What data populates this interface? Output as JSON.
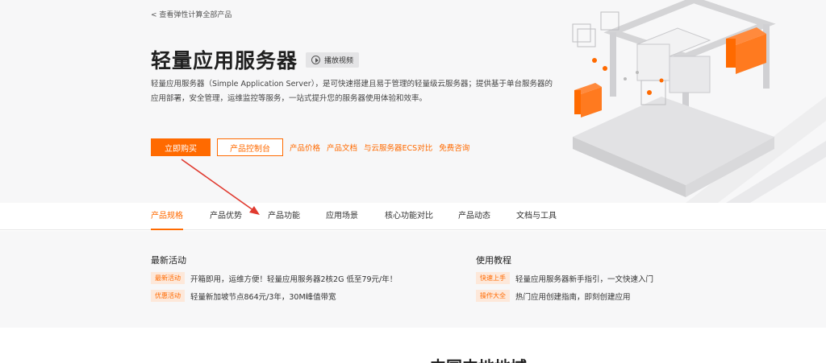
{
  "hero": {
    "back_link": "< 查看弹性计算全部产品",
    "title": "轻量应用服务器",
    "video_label": "播放视频",
    "description": "轻量应用服务器（Simple Application Server），是可快速搭建且易于管理的轻量级云服务器；提供基于单台服务器的应用部署，安全管理，运维监控等服务，一站式提升您的服务器使用体验和效率。",
    "buy_label": "立即购买",
    "console_label": "产品控制台",
    "links": [
      "产品价格",
      "产品文档",
      "与云服务器ECS对比",
      "免费咨询"
    ]
  },
  "tabs": [
    {
      "label": "产品规格",
      "active": true
    },
    {
      "label": "产品优势",
      "active": false
    },
    {
      "label": "产品功能",
      "active": false
    },
    {
      "label": "应用场景",
      "active": false
    },
    {
      "label": "核心功能对比",
      "active": false
    },
    {
      "label": "产品动态",
      "active": false
    },
    {
      "label": "文档与工具",
      "active": false
    }
  ],
  "activities": {
    "title": "最新活动",
    "items": [
      {
        "tag": "最新活动",
        "text": "开箱即用，运维方便！轻量应用服务器2核2G 低至79元/年！"
      },
      {
        "tag": "优惠活动",
        "text": "轻量新加坡节点864元/3年，30M峰值带宽"
      }
    ]
  },
  "tutorials": {
    "title": "使用教程",
    "items": [
      {
        "tag": "快速上手",
        "text": "轻量应用服务器新手指引，一文快速入门"
      },
      {
        "tag": "操作大全",
        "text": "热门应用创建指南，即刻创建应用"
      }
    ]
  },
  "bottom_title": "中国内地地域",
  "colors": {
    "accent": "#ff6a00",
    "tag_bg": "#fde8da",
    "arrow": "#e03a2f"
  }
}
